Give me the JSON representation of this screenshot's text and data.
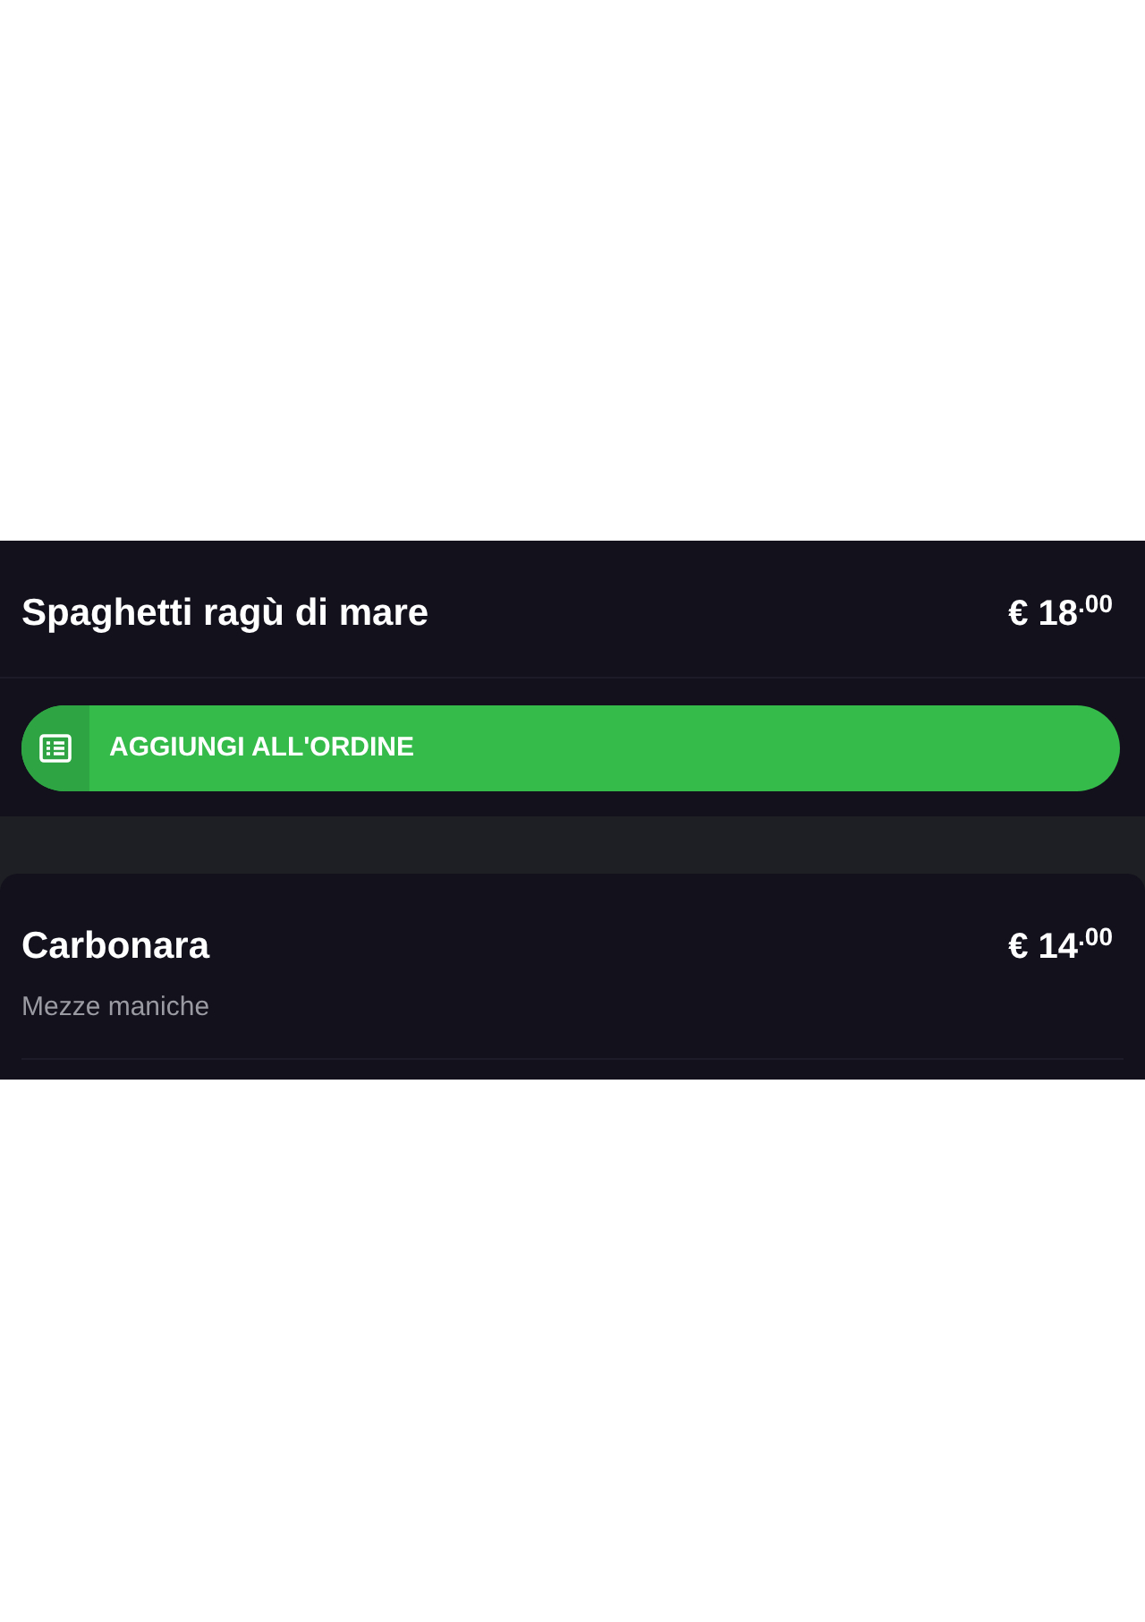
{
  "items": [
    {
      "name": "Spaghetti ragù di mare",
      "price": "€ 18$^{.00}$",
      "button": {
        "label": "AGGIUNGI ALL'ORDINE"
      }
    },
    {
      "name": "Carbonara",
      "price": "€ 14$^{.00}$",
      "description": "Mezze maniche"
    }
  ]
}
